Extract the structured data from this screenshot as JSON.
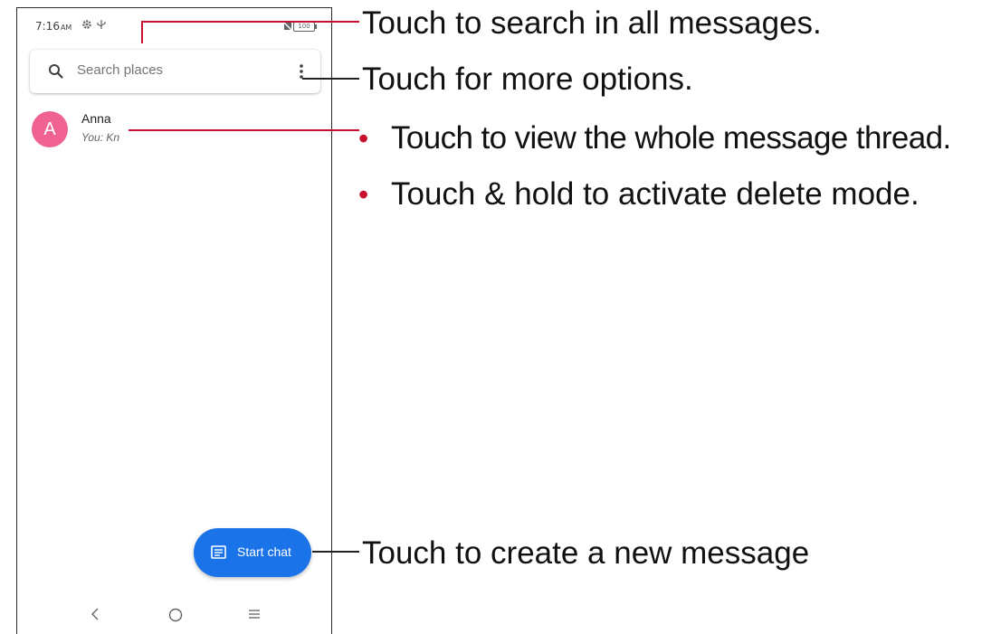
{
  "status_bar": {
    "time": "7:16",
    "ampm": "AM",
    "battery": "100"
  },
  "search": {
    "placeholder": "Search places"
  },
  "conversations": [
    {
      "avatar_letter": "A",
      "name": "Anna",
      "snippet": "You: Kn",
      "avatar_color": "#f06292"
    }
  ],
  "fab": {
    "label": "Start chat",
    "color": "#1a73e8"
  },
  "callouts": {
    "search": "Touch to search in all messages.",
    "options": "Touch for more options.",
    "thread_view": "Touch to view the whole message thread.",
    "thread_delete": "Touch & hold to activate delete mode.",
    "new_message": "Touch to create a new message"
  },
  "colors": {
    "callout_line": "#c8102e",
    "bullet": "#c8102e"
  }
}
